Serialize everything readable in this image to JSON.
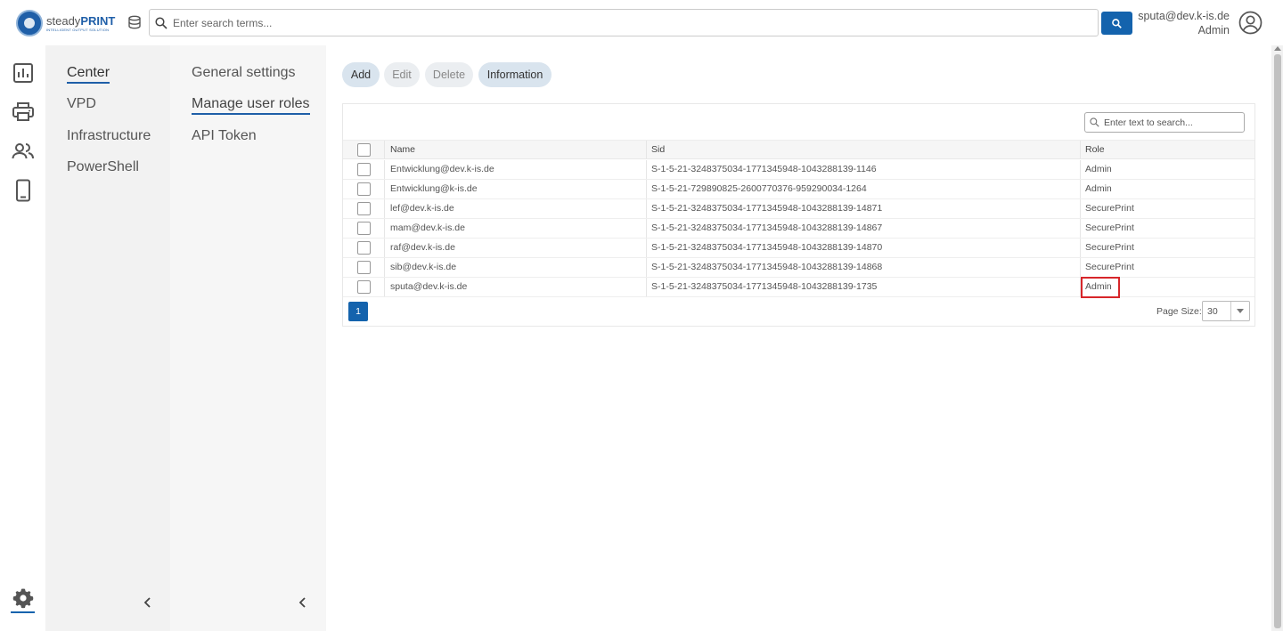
{
  "header": {
    "logo_main": "steady",
    "logo_bold": "PRINT",
    "logo_sub": "INTELLIGENT OUTPUT SOLUTION",
    "search_placeholder": "Enter search terms...",
    "user_email": "sputa@dev.k-is.de",
    "user_role": "Admin"
  },
  "nav1": {
    "items": [
      {
        "label": "Center"
      },
      {
        "label": "VPD"
      },
      {
        "label": "Infrastructure"
      },
      {
        "label": "PowerShell"
      }
    ]
  },
  "nav2": {
    "items": [
      {
        "label": "General settings"
      },
      {
        "label": "Manage user roles"
      },
      {
        "label": "API Token"
      }
    ]
  },
  "toolbar": {
    "add": "Add",
    "edit": "Edit",
    "delete": "Delete",
    "information": "Information"
  },
  "grid": {
    "search_placeholder": "Enter text to search...",
    "columns": {
      "name": "Name",
      "sid": "Sid",
      "role": "Role"
    },
    "rows": [
      {
        "name": "Entwicklung@dev.k-is.de",
        "sid": "S-1-5-21-3248375034-1771345948-1043288139-1146",
        "role": "Admin"
      },
      {
        "name": "Entwicklung@k-is.de",
        "sid": "S-1-5-21-729890825-2600770376-959290034-1264",
        "role": "Admin"
      },
      {
        "name": "lef@dev.k-is.de",
        "sid": "S-1-5-21-3248375034-1771345948-1043288139-14871",
        "role": "SecurePrint"
      },
      {
        "name": "mam@dev.k-is.de",
        "sid": "S-1-5-21-3248375034-1771345948-1043288139-14867",
        "role": "SecurePrint"
      },
      {
        "name": "raf@dev.k-is.de",
        "sid": "S-1-5-21-3248375034-1771345948-1043288139-14870",
        "role": "SecurePrint"
      },
      {
        "name": "sib@dev.k-is.de",
        "sid": "S-1-5-21-3248375034-1771345948-1043288139-14868",
        "role": "SecurePrint"
      },
      {
        "name": "sputa@dev.k-is.de",
        "sid": "S-1-5-21-3248375034-1771345948-1043288139-1735",
        "role": "Admin"
      }
    ],
    "current_page": "1",
    "page_size_label": "Page Size:",
    "page_size": "30"
  },
  "colors": {
    "accent": "#1463ad",
    "highlight": "#d7262a"
  },
  "icons": [
    "database-icon",
    "search-icon",
    "user-avatar-icon",
    "chart-icon",
    "printer-icon",
    "users-icon",
    "mobile-icon",
    "gear-icon",
    "chevron-left-icon"
  ]
}
